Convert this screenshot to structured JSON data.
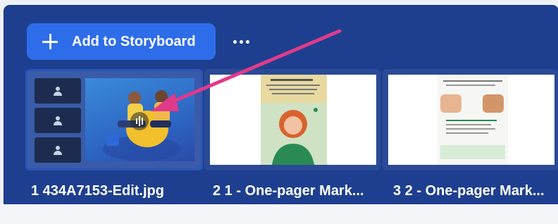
{
  "toolbar": {
    "add_label": "Add to Storyboard"
  },
  "thumbnails": [
    {
      "label": "1 434A7153-Edit.jpg"
    },
    {
      "label": "2 1 - One-pager Mark..."
    },
    {
      "label": "3 2 - One-pager Mark..."
    }
  ],
  "colors": {
    "panel": "#1e3f8f",
    "button": "#2e6dea",
    "annotation_arrow": "#e03a8a"
  }
}
